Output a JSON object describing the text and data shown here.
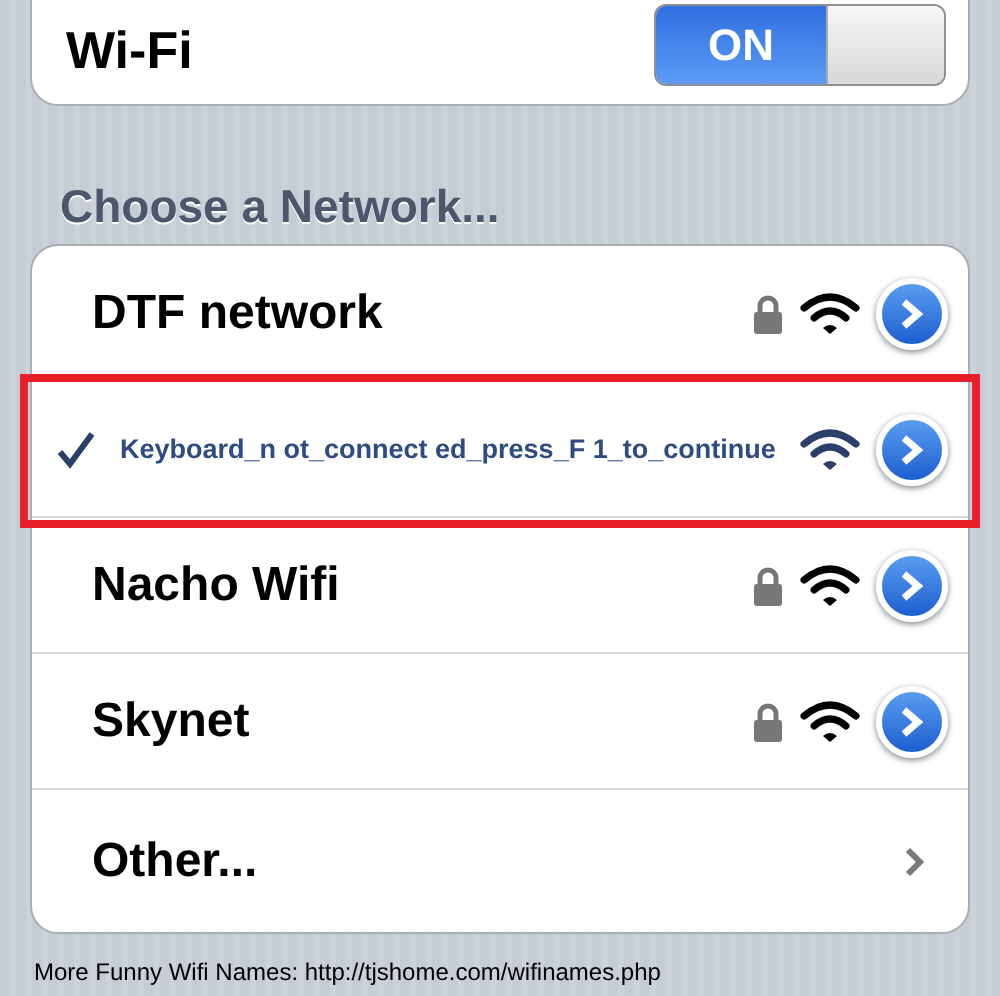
{
  "wifi": {
    "label": "Wi-Fi",
    "on": true,
    "state_label": "ON"
  },
  "section_title": "Choose a Network...",
  "networks": [
    {
      "name": "DTF network",
      "selected": false,
      "locked": true,
      "highlighted": false
    },
    {
      "name": "Keyboard_n ot_connect ed_press_F 1_to_continue",
      "selected": true,
      "locked": false,
      "highlighted": true
    },
    {
      "name": "Nacho Wifi",
      "selected": false,
      "locked": true,
      "highlighted": false
    },
    {
      "name": "Skynet",
      "selected": false,
      "locked": true,
      "highlighted": false
    }
  ],
  "other": {
    "label": "Other..."
  },
  "footer": "More Funny Wifi Names: http://tjshome.com/wifinames.php"
}
